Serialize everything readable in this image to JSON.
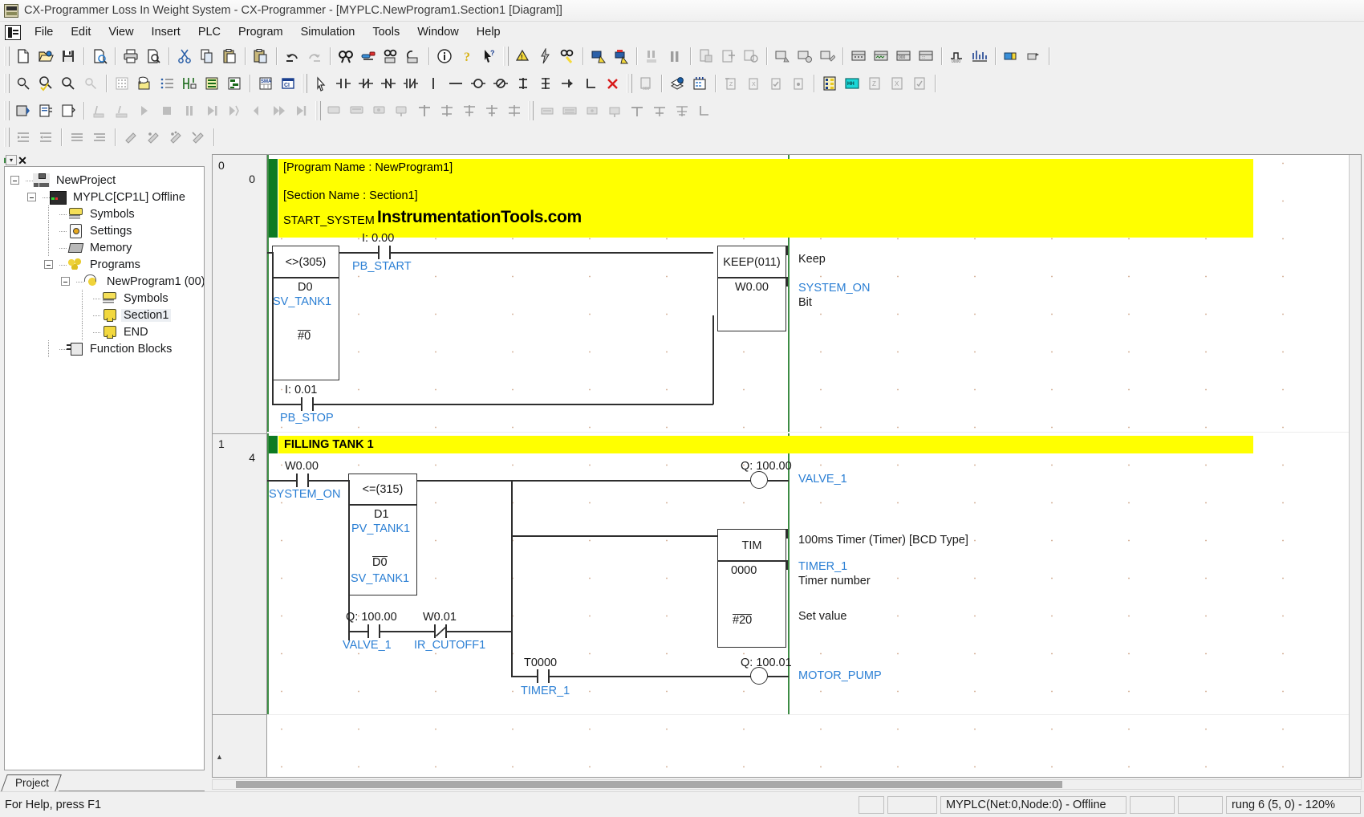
{
  "window": {
    "title": "CX-Programmer Loss In Weight System - CX-Programmer - [MYPLC.NewProgram1.Section1 [Diagram]]",
    "app_icon": "cx-programmer-icon"
  },
  "menu": {
    "items": [
      "File",
      "Edit",
      "View",
      "Insert",
      "PLC",
      "Program",
      "Simulation",
      "Tools",
      "Window",
      "Help"
    ]
  },
  "toolbar": {
    "row1": [
      "new-icon",
      "open-icon",
      "save-icon",
      "print-setup-icon",
      "print-icon",
      "print-preview-icon",
      "cut-icon",
      "copy-icon",
      "paste-icon",
      "paste-special-icon",
      "undo-icon",
      "redo-icon",
      "find-icon",
      "replace-icon",
      "find-next-icon",
      "find-prev-icon",
      "properties-icon",
      "help-icon",
      "context-help-icon"
    ],
    "row1b": [
      "work-online-icon",
      "auto-online-icon",
      "online-compare-icon",
      "transfer-to-plc-icon",
      "transfer-from-plc-icon",
      "plc-run-icon",
      "plc-pause-icon",
      "compile-icon",
      "program-check-icon",
      "memory-view-icon",
      "io-table-icon",
      "io-compare-icon",
      "io-edit-icon",
      "monitor1-icon",
      "monitor2-icon",
      "monitor3-icon",
      "monitor4-icon",
      "timechart-icon",
      "datatrace-icon",
      "cx-simulator-icon",
      "cx-debug-icon"
    ],
    "row2": [
      "zoom-icon",
      "zoom-fit-icon",
      "zoom-out-icon",
      "zoom-default-icon",
      "grid-icon",
      "comment-icon",
      "rung-comment-icon",
      "show-symbols-icon",
      "symbol-table-icon",
      "section-list-icon",
      "sma-icon",
      "cross-ref-icon",
      "select-mode-icon",
      "new-contact-icon",
      "new-contact-not-icon",
      "new-closed-contact-icon",
      "new-closed-contact-not-icon",
      "vertical-icon",
      "horizontal-icon",
      "new-coil-icon",
      "new-coil-inverted-icon",
      "new-pls-icon",
      "new-plf-icon",
      "new-inst-icon",
      "new-link-icon",
      "delete-link-icon",
      "new-fb-icon",
      "fb-library-icon",
      "fb-generate-icon",
      "insert-row-icon",
      "delete-row-icon",
      "insert-column-icon",
      "delete-column-icon",
      "ladder-view-icon",
      "mnemonic-view-icon",
      "address-ref-icon",
      "cross-ref-popup-icon",
      "output-window-icon"
    ],
    "row3": [
      "toggle-mode-icon",
      "differential-monitor-icon",
      "set-value-icon",
      "force-on-icon",
      "force-off-icon",
      "force-cancel-icon",
      "set-on-icon",
      "set-off-icon",
      "clear-force-icon",
      "decimal-icon",
      "signed-decimal-icon",
      "hex-icon",
      "monitor-in-hex-icon",
      "pause-icon",
      "resume-icon",
      "simulation-start-icon",
      "simulation-stop-icon",
      "simulation-pause-icon",
      "simulation-step-icon",
      "step-run-icon",
      "step-in-icon",
      "scan-run-icon",
      "continuous-step-icon",
      "break-point-icon",
      "clear-breakpoints-icon",
      "run-to-cursor-icon",
      "watch-window-icon",
      "align-a-icon",
      "align-b-icon",
      "align-c-icon",
      "align-d-icon",
      "align-e-icon",
      "corner-icon"
    ],
    "row4": [
      "indent-increase-icon",
      "indent-decrease-icon",
      "list-left-icon",
      "list-right-icon",
      "pin-a-icon",
      "pin-b-icon",
      "pin-c-icon",
      "pin-d-icon"
    ]
  },
  "project_tree": {
    "panel_title_buttons": [
      "minimize-dropdown-button",
      "close-button"
    ],
    "nodes": [
      {
        "label": "NewProject",
        "depth": 0,
        "icon": "network-icon",
        "expander": "minus",
        "selected": false
      },
      {
        "label": "MYPLC[CP1L] Offline",
        "depth": 1,
        "icon": "plc-icon",
        "expander": "minus",
        "selected": false
      },
      {
        "label": "Symbols",
        "depth": 2,
        "icon": "symbols-icon",
        "expander": "none",
        "selected": false
      },
      {
        "label": "Settings",
        "depth": 2,
        "icon": "settings-icon",
        "expander": "none",
        "selected": false
      },
      {
        "label": "Memory",
        "depth": 2,
        "icon": "memory-icon",
        "expander": "none",
        "selected": false
      },
      {
        "label": "Programs",
        "depth": 2,
        "icon": "programs-icon",
        "expander": "minus",
        "selected": false
      },
      {
        "label": "NewProgram1 (00)",
        "depth": 3,
        "icon": "program-icon",
        "expander": "minus",
        "selected": false
      },
      {
        "label": "Symbols",
        "depth": 4,
        "icon": "symbols-icon",
        "expander": "none",
        "selected": false
      },
      {
        "label": "Section1",
        "depth": 4,
        "icon": "section-icon",
        "expander": "none",
        "selected": true
      },
      {
        "label": "END",
        "depth": 4,
        "icon": "section-icon",
        "expander": "none",
        "selected": false
      },
      {
        "label": "Function Blocks",
        "depth": 2,
        "icon": "function-block-icon",
        "expander": "none",
        "selected": false
      }
    ],
    "tab": "Project"
  },
  "ladder": {
    "rungs": [
      {
        "index": "0",
        "step": "0",
        "comments": [
          "[Program Name : NewProgram1]",
          "[Section Name : Section1]",
          "START_SYSTEM"
        ],
        "watermark": "InstrumentationTools.com"
      },
      {
        "index": "1",
        "step": "4",
        "comments": [
          "FILLING TANK 1"
        ],
        "watermark": ""
      }
    ],
    "rung0": {
      "compare_block": {
        "instruction": "<>(305)",
        "operand1_addr": "D0",
        "operand1_sym": "SV_TANK1",
        "operand2_addr": "#0"
      },
      "contact_start": {
        "addr": "I: 0.00",
        "sym": "PB_START",
        "type": "NO"
      },
      "contact_stop": {
        "addr": "I: 0.01",
        "sym": "PB_STOP",
        "type": "NO"
      },
      "keep_block": {
        "instruction": "KEEP(011)",
        "operand_addr": "W0.00",
        "desc_title": "Keep",
        "desc_sym": "SYSTEM_ON",
        "desc_sub": "Bit"
      }
    },
    "rung1": {
      "contact_system_on": {
        "addr": "W0.00",
        "sym": "SYSTEM_ON",
        "type": "NO"
      },
      "compare_block": {
        "instruction": "<=(315)",
        "operand1_addr": "D1",
        "operand1_sym": "PV_TANK1",
        "operand2_addr": "D0",
        "operand2_sym": "SV_TANK1"
      },
      "contact_valve": {
        "addr": "Q: 100.00",
        "sym": "VALVE_1",
        "type": "NO"
      },
      "contact_cutoff": {
        "addr": "W0.01",
        "sym": "IR_CUTOFF1",
        "type": "NC"
      },
      "coil_valve": {
        "addr": "Q: 100.00",
        "sym": "VALVE_1"
      },
      "timer_block": {
        "instruction": "TIM",
        "operand_number": "0000",
        "operand_setvalue": "#20",
        "desc_title": "100ms Timer (Timer) [BCD Type]",
        "desc_sym": "TIMER_1",
        "desc_sub": "Timer number",
        "desc_sv": "Set value"
      },
      "contact_timer": {
        "addr": "T0000",
        "sym": "TIMER_1",
        "type": "NO"
      },
      "coil_motor": {
        "addr": "Q: 100.01",
        "sym": "MOTOR_PUMP"
      }
    }
  },
  "statusbar": {
    "help_text": "For Help, press F1",
    "panes": [
      "",
      "",
      "MYPLC(Net:0,Node:0) - Offline",
      "",
      "",
      "rung 6 (5, 0)  - 120%"
    ]
  },
  "colors": {
    "comment_bg": "#ffff00",
    "symbol_text": "#2b7fd4",
    "bus_rail": "#3d8c44",
    "rung_marker": "#0d7a22",
    "wire": "#2e2e2e",
    "selection_bg": "#eceff3"
  }
}
